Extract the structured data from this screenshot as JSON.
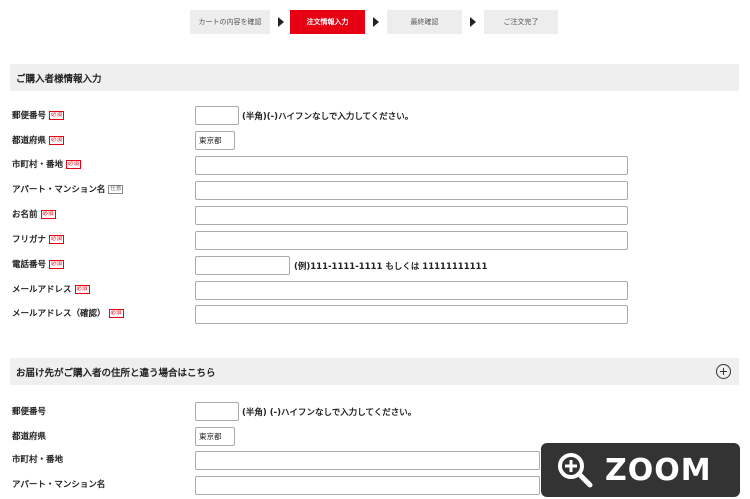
{
  "steps": [
    "カートの内容を確認",
    "注文情報入力",
    "最終確認",
    "ご注文完了"
  ],
  "active_step": "注文情報入力",
  "purchaser_section": {
    "title": "ご購入者様情報入力",
    "fields": [
      {
        "label": "郵便番号",
        "badge": "必須",
        "hint": "(半角)(-)ハイフンなしで入力してください。"
      },
      {
        "label": "都道府県",
        "badge": "必須",
        "value": "東京都"
      },
      {
        "label": "市町村・番地",
        "badge": "必須"
      },
      {
        "label": "アパート・マンション名",
        "badge": "任意"
      },
      {
        "label": "お名前",
        "badge": "必須"
      },
      {
        "label": "フリガナ",
        "badge": "必須"
      },
      {
        "label": "電話番号",
        "badge": "必須",
        "hint": "(例)111-1111-1111 もしくは 11111111111"
      },
      {
        "label": "メールアドレス",
        "badge": "必須"
      },
      {
        "label": "メールアドレス（確認）",
        "badge": "必須"
      }
    ]
  },
  "delivery_section": {
    "title": "お届け先がご購入者の住所と違う場合はこちら",
    "fields": [
      {
        "label": "郵便番号",
        "hint": "(半角) (-)ハイフンなしで入力してください。"
      },
      {
        "label": "都道府県",
        "value": "東京都"
      },
      {
        "label": "市町村・番地"
      },
      {
        "label": "アパート・マンション名"
      }
    ]
  },
  "zoom_label": "ZOOM",
  "colors": {
    "accent": "#e60012",
    "section_bg": "#efefef",
    "zoom_bg": "#333333"
  }
}
